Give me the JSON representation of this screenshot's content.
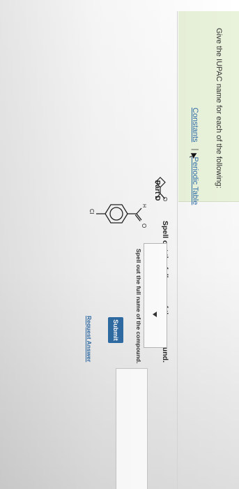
{
  "header": {
    "constants_link": "Constants",
    "separator": "|",
    "periodic_table_link": "Periodic Table",
    "instructions": "Give the IUPAC name for each of the following:"
  },
  "part_c": {
    "structure": {
      "atoms": [
        "O"
      ]
    },
    "prompt": "Spell out the full name of the compound.",
    "answer_value": "",
    "submit_label": "Submit",
    "request_answer_label": "Request Answer"
  },
  "part_d": {
    "title": "Part D",
    "structure": {
      "atoms": [
        "O",
        "Cl",
        "H"
      ]
    },
    "prompt": "Spell out the full name of the compound.",
    "answer_value": ""
  },
  "colors": {
    "prompt_bar": "#e9f2da",
    "link": "#2e6ca8",
    "submit_button": "#2f6ea6"
  },
  "icons": {
    "cursor": "mouse-pointer-icon",
    "expand": "triangle-down-icon"
  }
}
